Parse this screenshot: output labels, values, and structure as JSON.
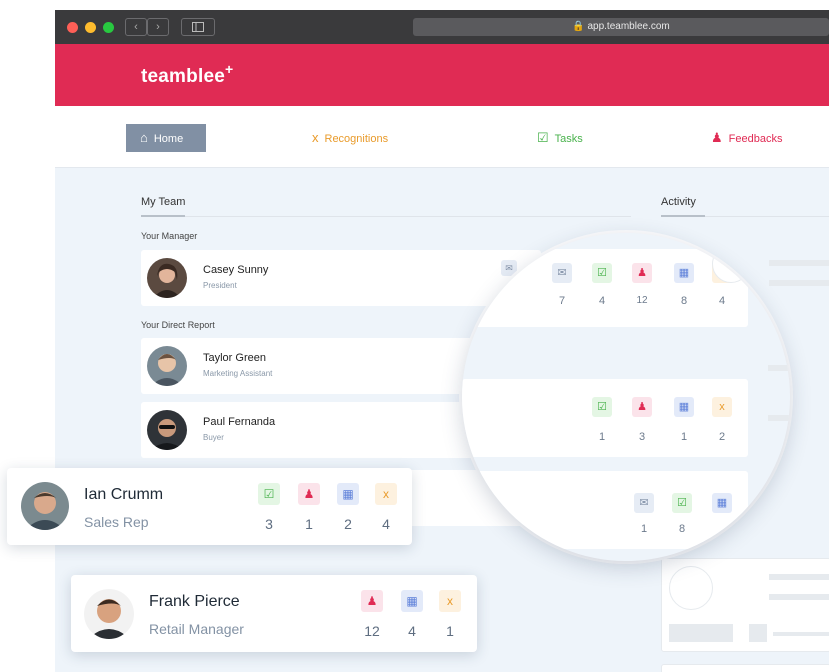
{
  "browser": {
    "url": "app.teamblee.com",
    "lock_icon": "lock-icon"
  },
  "brand": {
    "logo": "teamblee",
    "logo_plus": "+",
    "color": "#e02b54"
  },
  "tabs": [
    {
      "label": "Home",
      "icon": "home-icon",
      "color": "#ffffff"
    },
    {
      "label": "Recognitions",
      "icon": "recognition-icon",
      "color": "#e99b2b"
    },
    {
      "label": "Tasks",
      "icon": "task-icon",
      "color": "#49b24c"
    },
    {
      "label": "Feedbacks",
      "icon": "feedback-icon",
      "color": "#e02b54"
    }
  ],
  "my_team": {
    "title": "My Team",
    "manager_label": "Your Manager",
    "manager": {
      "name": "Casey Sunny",
      "role": "President"
    },
    "direct_report_label": "Your Direct Report",
    "reports": [
      {
        "name": "Taylor Green",
        "role": "Marketing Assistant"
      },
      {
        "name": "Paul Fernanda",
        "role": "Buyer"
      }
    ]
  },
  "activity": {
    "title": "Activity"
  },
  "magnified": {
    "row1": {
      "msg": "7",
      "task": "4",
      "feedback": "12",
      "calendar": "8",
      "recognition": "4"
    },
    "row2": {
      "task": "1",
      "feedback": "3",
      "calendar": "1",
      "recognition": "2"
    },
    "row3": {
      "msg": "1",
      "task": "8"
    }
  },
  "floating_cards": [
    {
      "name": "Ian Crumm",
      "role": "Sales Rep",
      "task": "3",
      "feedback": "1",
      "calendar": "2",
      "recognition": "4"
    },
    {
      "name": "Frank Pierce",
      "role": "Retail Manager",
      "feedback": "12",
      "calendar": "4",
      "recognition": "1"
    }
  ]
}
